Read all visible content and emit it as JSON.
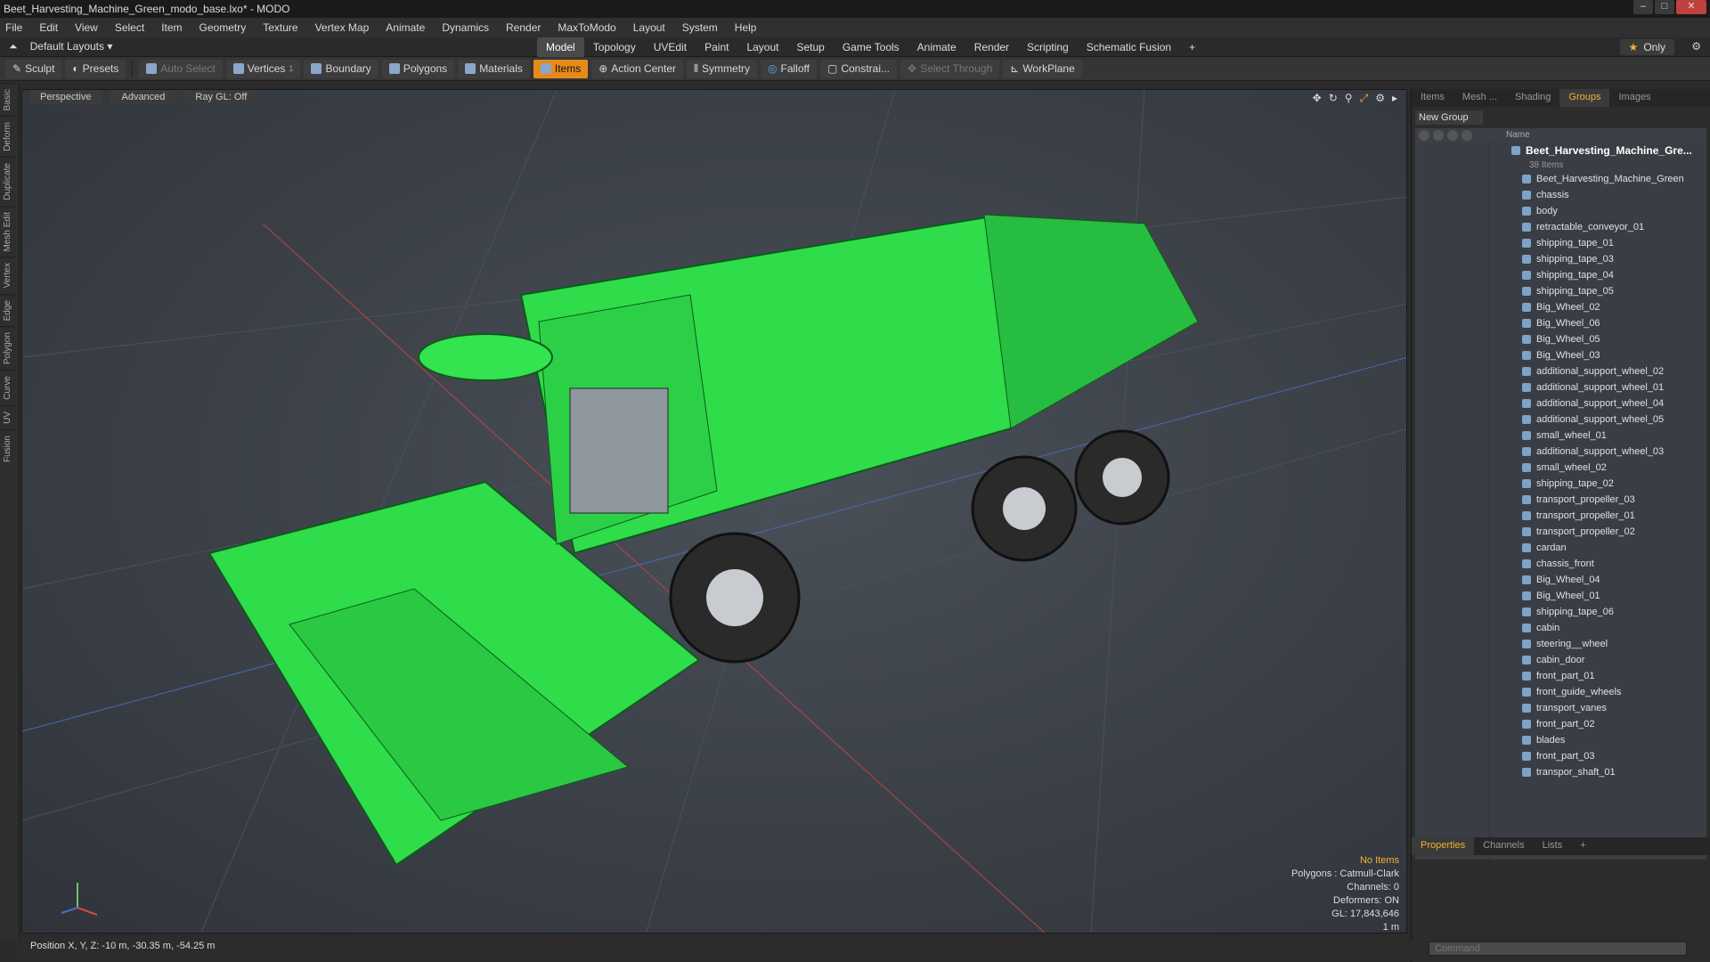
{
  "window": {
    "title": "Beet_Harvesting_Machine_Green_modo_base.lxo* - MODO"
  },
  "menu": [
    "File",
    "Edit",
    "View",
    "Select",
    "Item",
    "Geometry",
    "Texture",
    "Vertex Map",
    "Animate",
    "Dynamics",
    "Render",
    "MaxToModo",
    "Layout",
    "System",
    "Help"
  ],
  "modebar": {
    "layouts": "Default Layouts",
    "tabs": [
      "Model",
      "Topology",
      "UVEdit",
      "Paint",
      "Layout",
      "Setup",
      "Game Tools",
      "Animate",
      "Render",
      "Scripting",
      "Schematic Fusion",
      "+"
    ],
    "active_tab": "Model",
    "only": "Only"
  },
  "toolbar": {
    "sculpt": "Sculpt",
    "presets": "Presets",
    "auto_select": "Auto Select",
    "vertices": "Vertices",
    "vertices_count": "1",
    "boundary": "Boundary",
    "polygons": "Polygons",
    "materials": "Materials",
    "items": "Items",
    "action_center": "Action Center",
    "symmetry": "Symmetry",
    "falloff": "Falloff",
    "constraints": "Constrai...",
    "select_through": "Select Through",
    "workplane": "WorkPlane"
  },
  "left_tabs": [
    "Basic",
    "Deform",
    "Duplicate",
    "Mesh Edit",
    "Vertex",
    "Edge",
    "Polygon",
    "Curve",
    "UV",
    "Fusion"
  ],
  "viewport": {
    "view": "Perspective",
    "advanced": "Advanced",
    "raygl": "Ray GL: Off",
    "info": {
      "no_items": "No Items",
      "polygons": "Polygons : Catmull-Clark",
      "channels": "Channels: 0",
      "deformers": "Deformers: ON",
      "gl": "GL: 17,843,646",
      "scale": "1 m"
    }
  },
  "status": {
    "position": "Position X, Y, Z:  -10 m, -30.35 m, -54.25 m"
  },
  "panel": {
    "tabs": [
      "Items",
      "Mesh ...",
      "Shading",
      "Groups",
      "Images"
    ],
    "active_tab": "Groups",
    "new_group": "New Group",
    "col_name": "Name",
    "root": "Beet_Harvesting_Machine_Gre...",
    "root_count": "38 Items",
    "items": [
      "Beet_Harvesting_Machine_Green",
      "chassis",
      "body",
      "retractable_conveyor_01",
      "shipping_tape_01",
      "shipping_tape_03",
      "shipping_tape_04",
      "shipping_tape_05",
      "Big_Wheel_02",
      "Big_Wheel_06",
      "Big_Wheel_05",
      "Big_Wheel_03",
      "additional_support_wheel_02",
      "additional_support_wheel_01",
      "additional_support_wheel_04",
      "additional_support_wheel_05",
      "small_wheel_01",
      "additional_support_wheel_03",
      "small_wheel_02",
      "shipping_tape_02",
      "transport_propeller_03",
      "transport_propeller_01",
      "transport_propeller_02",
      "cardan",
      "chassis_front",
      "Big_Wheel_04",
      "Big_Wheel_01",
      "shipping_tape_06",
      "cabin",
      "steering__wheel",
      "cabin_door",
      "front_part_01",
      "front_guide_wheels",
      "transport_vanes",
      "front_part_02",
      "blades",
      "front_part_03",
      "transpor_shaft_01"
    ],
    "bottom_tabs": [
      "Properties",
      "Channels",
      "Lists",
      "+"
    ],
    "command_placeholder": "Command"
  },
  "colors": {
    "accent": "#e88a1a",
    "model_green": "#2fdc4a"
  }
}
